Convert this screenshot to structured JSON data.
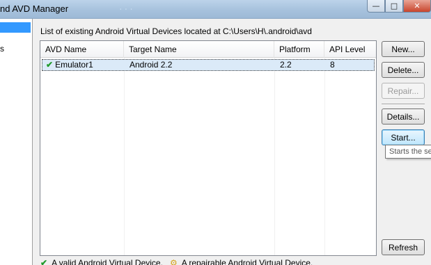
{
  "window": {
    "title": "nd AVD Manager",
    "ghost_text": "...",
    "controls": {
      "minimize": "—",
      "maximize": "□",
      "close": "✕"
    }
  },
  "sidebar": {
    "fragment": "s"
  },
  "main": {
    "list_label": "List of existing Android Virtual Devices located at C:\\Users\\H\\.android\\avd",
    "columns": [
      "AVD Name",
      "Target Name",
      "Platform",
      "API Level"
    ],
    "rows": [
      {
        "status_icon": "check-icon",
        "name": "Emulator1",
        "target": "Android 2.2",
        "platform": "2.2",
        "api": "8"
      }
    ]
  },
  "buttons": {
    "new": "New...",
    "delete": "Delete...",
    "repair": "Repair...",
    "details": "Details...",
    "start": "Start...",
    "refresh": "Refresh"
  },
  "tooltip": "Starts the se",
  "legend": {
    "valid": "A valid Android Virtual Device.",
    "repairable": "A repairable Android Virtual Device."
  },
  "colors": {
    "selection": "#3399ff",
    "check": "#1f9a2a"
  }
}
